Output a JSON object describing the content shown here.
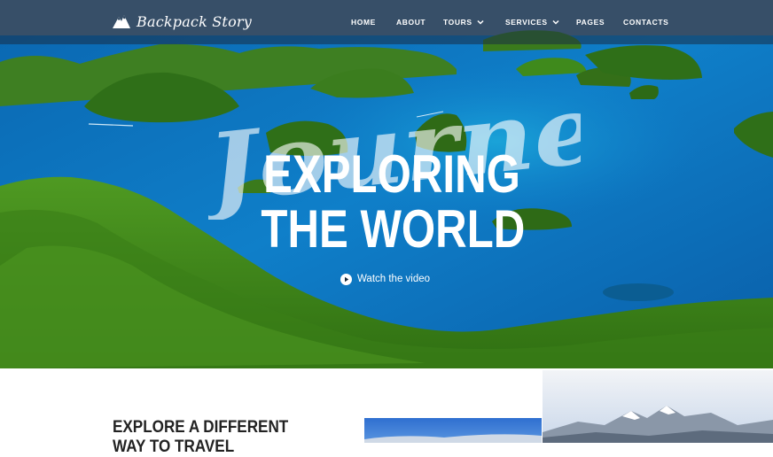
{
  "brand": {
    "logo_text": "Backpack Story",
    "logo_icon": "mountain-icon"
  },
  "nav": [
    {
      "label": "HOME"
    },
    {
      "label": "ABOUT"
    },
    {
      "label": "TOURS",
      "icon": "chevron-down-icon"
    },
    {
      "label": "SERVICES",
      "icon": "chevron-down-icon"
    },
    {
      "label": "PAGES"
    },
    {
      "label": "CONTACTS"
    }
  ],
  "hero": {
    "script_word": "Journey",
    "title_line1": "EXPLORING",
    "title_line2": "THE WORLD",
    "video_link": "Watch the video",
    "video_icon": "play-circle-icon"
  },
  "section": {
    "title_line1": "EXPLORE A DIFFERENT",
    "title_line2": "WAY TO TRAVEL"
  },
  "colors": {
    "lagoon": "#0b6fb8",
    "forest": "#3f8a1c",
    "nav_bg": "#2d4660",
    "text_dark": "#222222"
  }
}
